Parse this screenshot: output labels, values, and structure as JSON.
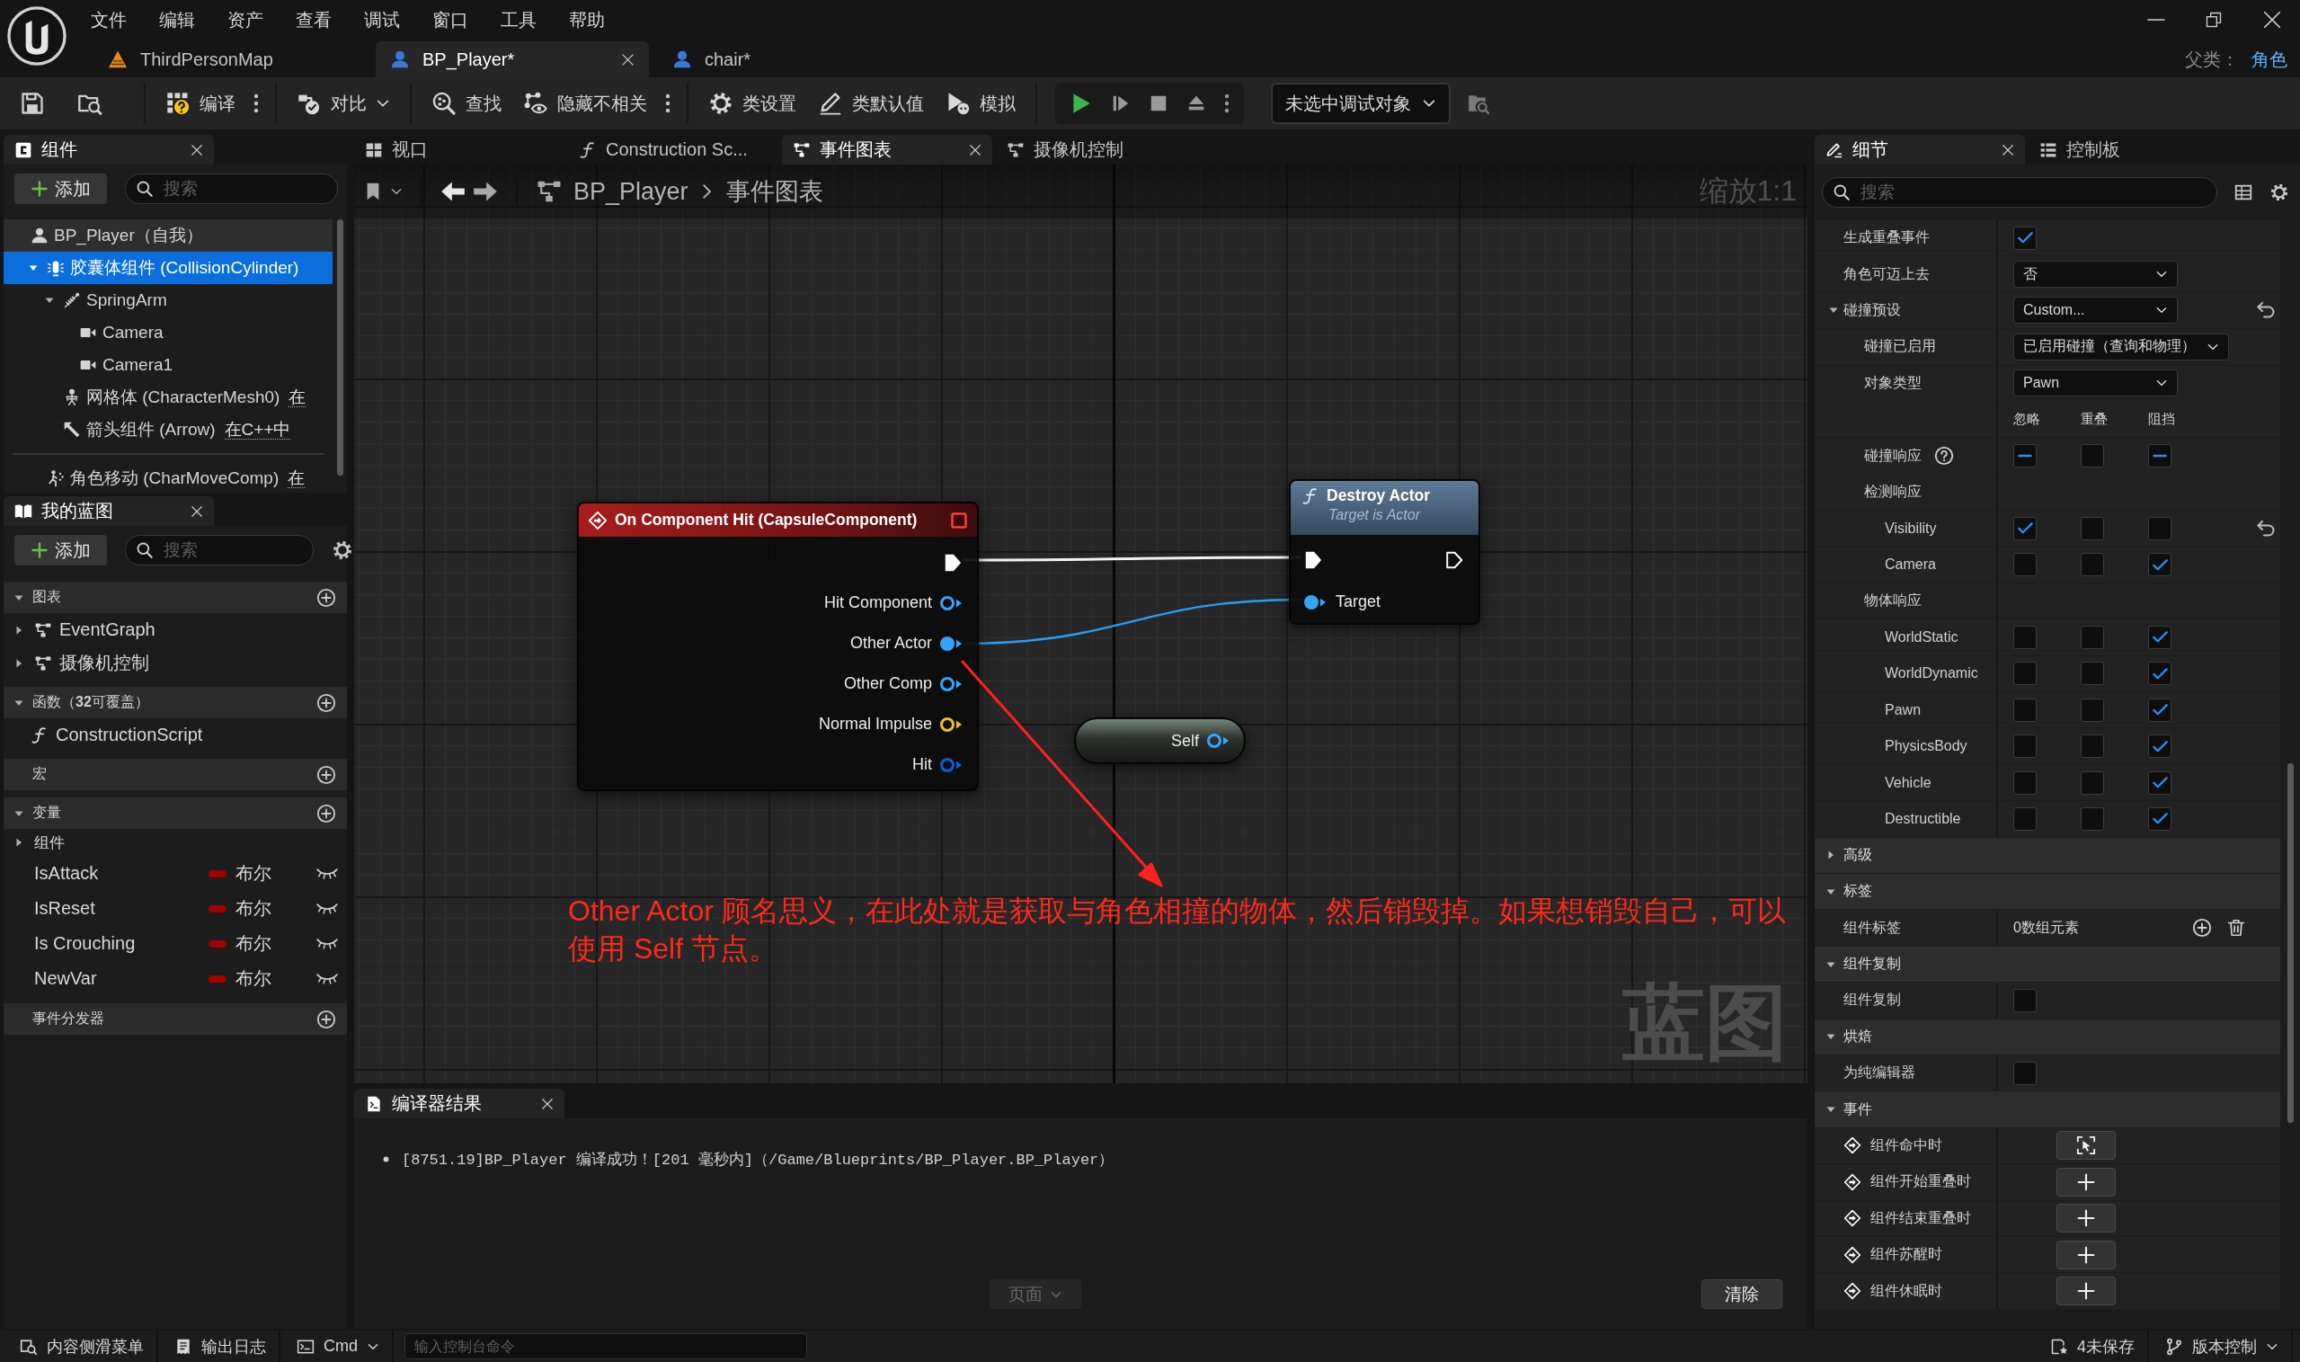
{
  "menu": [
    "文件",
    "编辑",
    "资产",
    "查看",
    "调试",
    "窗口",
    "工具",
    "帮助"
  ],
  "doc_tabs": [
    {
      "label": "ThirdPersonMap",
      "kind": "level",
      "selected": false
    },
    {
      "label": "BP_Player*",
      "kind": "blueprint",
      "selected": true
    },
    {
      "label": "chair*",
      "kind": "blueprint",
      "selected": false
    }
  ],
  "parent_class": {
    "label": "父类：",
    "value": "角色"
  },
  "toolbar": {
    "items": [
      {
        "kind": "compile",
        "label": "编译",
        "more": true
      },
      {
        "kind": "diff",
        "label": "对比",
        "dropdown": true
      },
      {
        "kind": "find",
        "label": "查找"
      },
      {
        "kind": "hide",
        "label": "隐藏不相关",
        "more": true
      },
      {
        "kind": "settings",
        "label": "类设置"
      },
      {
        "kind": "defaults",
        "label": "类默认值"
      },
      {
        "kind": "simulate",
        "label": "模拟"
      }
    ],
    "debug_object": "未选中调试对象"
  },
  "components": {
    "tab": "组件",
    "add": "添加",
    "search_placeholder": "搜索",
    "tree": [
      {
        "kind": "actor",
        "label": "BP_Player（自我）",
        "selected": false,
        "children": [
          {
            "kind": "capsule",
            "label": "胶囊体组件 (CollisionCylinder)",
            "selected": true,
            "expanded": true,
            "children": [
              {
                "kind": "spring_arm",
                "label": "SpringArm",
                "selected": false,
                "expanded": true,
                "children": [
                  {
                    "kind": "camera",
                    "label": "Camera",
                    "selected": false
                  },
                  {
                    "kind": "camera",
                    "label": "Camera1",
                    "selected": false
                  }
                ]
              },
              {
                "kind": "mesh",
                "label": "网格体 (CharacterMesh0)",
                "note": "在",
                "selected": false
              },
              {
                "kind": "arrow",
                "label": "箭头组件 (Arrow)",
                "note": "在C++中",
                "selected": false
              }
            ]
          }
        ]
      }
    ],
    "other": [
      {
        "kind": "movement",
        "label": "角色移动 (CharMoveComp)",
        "note": "在",
        "selected": false
      }
    ]
  },
  "my_blueprint": {
    "tab": "我的蓝图",
    "add": "添加",
    "search_placeholder": "搜索",
    "sections": [
      {
        "label": "图表",
        "expanded": true,
        "items": [
          {
            "kind": "graph",
            "label": "EventGraph",
            "expanded": false
          },
          {
            "kind": "graph",
            "label": "摄像机控制",
            "expanded": false
          }
        ]
      },
      {
        "label": "函数（**32**可覆盖）",
        "expanded": true,
        "items": [
          {
            "kind": "function",
            "label": "ConstructionScript"
          }
        ]
      },
      {
        "label": "宏"
      },
      {
        "label": "变量",
        "expanded": true,
        "items": [
          {
            "kind": "category",
            "label": "组件",
            "expanded": false
          },
          {
            "kind": "variable",
            "label": "IsAttack",
            "type": "布尔",
            "color": "#a30000"
          },
          {
            "kind": "variable",
            "label": "IsReset",
            "type": "布尔",
            "color": "#a30000"
          },
          {
            "kind": "variable",
            "label": "Is Crouching",
            "type": "布尔",
            "color": "#a30000"
          },
          {
            "kind": "variable",
            "label": "NewVar",
            "type": "布尔",
            "color": "#a30000"
          }
        ]
      },
      {
        "label": "事件分发器"
      }
    ]
  },
  "graph_tabs": [
    {
      "label": "视口",
      "kind": "viewport",
      "selected": false
    },
    {
      "label": "Construction Sc...",
      "kind": "function",
      "selected": false
    },
    {
      "label": "事件图表",
      "kind": "graph",
      "selected": true
    },
    {
      "label": "摄像机控制",
      "kind": "graph",
      "selected": false
    }
  ],
  "graph": {
    "breadcrumb": [
      "BP_Player",
      "事件图表"
    ],
    "zoom": "缩放1:1",
    "watermark": "蓝图",
    "nodes": [
      {
        "kind": "event",
        "title": "On Component Hit (CapsuleComponent)",
        "outputs": [
          {
            "kind": "exec",
            "connected": true
          },
          {
            "kind": "data",
            "label": "Hit Component",
            "color": "#35a4ff",
            "connected": false
          },
          {
            "kind": "data",
            "label": "Other Actor",
            "color": "#35a4ff",
            "connected": true
          },
          {
            "kind": "data",
            "label": "Other Comp",
            "color": "#35a4ff",
            "connected": false
          },
          {
            "kind": "data",
            "label": "Normal Impulse",
            "color": "#f2c01e",
            "connected": false
          },
          {
            "kind": "data",
            "label": "Hit",
            "color": "#0a5fd6",
            "connected": false
          }
        ]
      },
      {
        "kind": "function",
        "title": "Destroy Actor",
        "subtitle": "Target is Actor",
        "inputs": [
          {
            "kind": "exec",
            "connected": true
          },
          {
            "kind": "data",
            "label": "Target",
            "color": "#35a4ff",
            "connected": true
          }
        ],
        "outputs": [
          {
            "kind": "exec",
            "connected": false
          }
        ]
      },
      {
        "kind": "self",
        "outputs": [
          {
            "kind": "data",
            "label": "Self",
            "color": "#35a4ff",
            "connected": false
          }
        ]
      }
    ],
    "note": "Other Actor 顾名思义，在此处就是获取与角色相撞的物体，然后销毁掉。如果想销毁自己，可以使用 Self 节点。"
  },
  "compiler": {
    "tab": "编译器结果",
    "messages": [
      "[8751.19]BP_Player 编译成功！[201 毫秒内]（/Game/Blueprints/BP_Player.BP_Player）"
    ],
    "page_button": {
      "label": "页面",
      "disabled": true
    },
    "clear_button": "清除"
  },
  "details": {
    "tabs": [
      {
        "label": "细节",
        "kind": "details",
        "selected": true
      },
      {
        "label": "控制板",
        "kind": "palette",
        "selected": false
      }
    ],
    "search_placeholder": "搜索",
    "rows": [
      {
        "kind": "checkbox",
        "label": "生成重叠事件",
        "checked": true
      },
      {
        "kind": "dropdown",
        "label": "角色可迈上去",
        "value": "否"
      },
      {
        "kind": "dropdown",
        "label": "碰撞预设",
        "value": "Custom...",
        "expanded": true,
        "resettable": true,
        "children": [
          {
            "kind": "dropdown",
            "label": "碰撞已启用",
            "value": "已启用碰撞（查询和物理）"
          },
          {
            "kind": "dropdown",
            "label": "对象类型",
            "value": "Pawn"
          },
          {
            "kind": "columns",
            "columns": [
              "忽略",
              "重叠",
              "阻挡"
            ]
          },
          {
            "kind": "response",
            "label": "碰撞响应",
            "help": true,
            "checks": [
              {
                "checked": true,
                "mixed": true
              },
              {
                "checked": false
              },
              {
                "checked": true,
                "mixed": true
              }
            ]
          },
          {
            "kind": "group",
            "label": "检测响应",
            "children": [
              {
                "kind": "response",
                "label": "Visibility",
                "checks": [
                  {
                    "checked": true
                  },
                  {
                    "checked": false
                  },
                  {
                    "checked": false
                  }
                ],
                "resettable": true
              },
              {
                "kind": "response",
                "label": "Camera",
                "checks": [
                  {
                    "checked": false
                  },
                  {
                    "checked": false
                  },
                  {
                    "checked": true
                  }
                ]
              }
            ]
          },
          {
            "kind": "group",
            "label": "物体响应",
            "children": [
              {
                "kind": "response",
                "label": "WorldStatic",
                "checks": [
                  {
                    "checked": false
                  },
                  {
                    "checked": false
                  },
                  {
                    "checked": true
                  }
                ]
              },
              {
                "kind": "response",
                "label": "WorldDynamic",
                "checks": [
                  {
                    "checked": false
                  },
                  {
                    "checked": false
                  },
                  {
                    "checked": true
                  }
                ]
              },
              {
                "kind": "response",
                "label": "Pawn",
                "checks": [
                  {
                    "checked": false
                  },
                  {
                    "checked": false
                  },
                  {
                    "checked": true
                  }
                ]
              },
              {
                "kind": "response",
                "label": "PhysicsBody",
                "checks": [
                  {
                    "checked": false
                  },
                  {
                    "checked": false
                  },
                  {
                    "checked": true
                  }
                ]
              },
              {
                "kind": "response",
                "label": "Vehicle",
                "checks": [
                  {
                    "checked": false
                  },
                  {
                    "checked": false
                  },
                  {
                    "checked": true
                  }
                ]
              },
              {
                "kind": "response",
                "label": "Destructible",
                "checks": [
                  {
                    "checked": false
                  },
                  {
                    "checked": false
                  },
                  {
                    "checked": true
                  }
                ]
              }
            ]
          }
        ]
      },
      {
        "kind": "category",
        "label": "高级",
        "expanded": false
      },
      {
        "kind": "category",
        "label": "标签",
        "expanded": true,
        "children": [
          {
            "kind": "array",
            "label": "组件标签",
            "value": "0数组元素"
          }
        ]
      },
      {
        "kind": "category",
        "label": "组件复制",
        "expanded": true,
        "children": [
          {
            "kind": "checkbox",
            "label": "组件复制",
            "checked": false
          }
        ]
      },
      {
        "kind": "category",
        "label": "烘焙",
        "expanded": true,
        "children": [
          {
            "kind": "checkbox",
            "label": "为纯编辑器",
            "checked": false
          }
        ]
      },
      {
        "kind": "category",
        "label": "事件",
        "expanded": true,
        "children": [
          {
            "kind": "event",
            "label": "组件命中时",
            "bound": true
          },
          {
            "kind": "event",
            "label": "组件开始重叠时",
            "bound": false
          },
          {
            "kind": "event",
            "label": "组件结束重叠时",
            "bound": false
          },
          {
            "kind": "event",
            "label": "组件苏醒时",
            "bound": false
          },
          {
            "kind": "event",
            "label": "组件休眠时",
            "bound": false
          }
        ]
      }
    ]
  },
  "status_bar": {
    "left": [
      {
        "kind": "drawer",
        "label": "内容侧滑菜单"
      },
      {
        "kind": "log",
        "label": "输出日志"
      },
      {
        "kind": "cmd",
        "label": "Cmd",
        "dropdown": true
      }
    ],
    "console_placeholder": "输入控制台命令",
    "right": [
      {
        "kind": "unsaved",
        "label": "4未保存"
      },
      {
        "kind": "vcs",
        "label": "版本控制",
        "dropdown": true
      }
    ]
  }
}
